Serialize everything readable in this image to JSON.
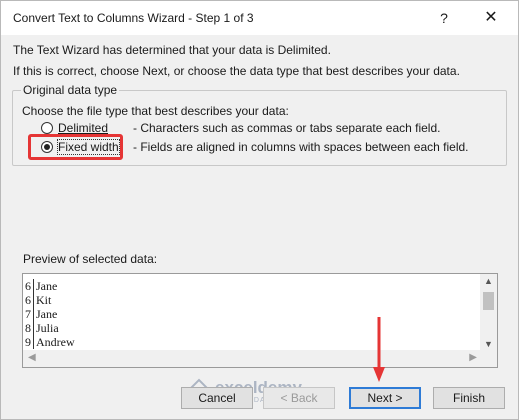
{
  "dialog": {
    "title": "Convert Text to Columns Wizard - Step 1 of 3",
    "help_glyph": "?",
    "close_glyph": "✕",
    "intro_line1": "The Text Wizard has determined that your data is Delimited.",
    "intro_line2": "If this is correct, choose Next, or choose the data type that best describes your data."
  },
  "original_data_type": {
    "legend": "Original data type",
    "prompt": "Choose the file type that best describes your data:",
    "options": [
      {
        "label": "Delimited",
        "description": "- Characters such as commas or tabs separate each field.",
        "selected": false
      },
      {
        "label": "Fixed width",
        "description": "- Fields are aligned in columns with spaces between each field.",
        "selected": true
      }
    ]
  },
  "preview": {
    "label": "Preview of selected data:",
    "rows": [
      {
        "num": "6",
        "value": "Jane"
      },
      {
        "num": "6",
        "value": "Kit"
      },
      {
        "num": "7",
        "value": "Jane"
      },
      {
        "num": "8",
        "value": "Julia"
      },
      {
        "num": "9",
        "value": "Andrew"
      }
    ]
  },
  "buttons": {
    "cancel": "Cancel",
    "back": "< Back",
    "next": "Next >",
    "finish": "Finish"
  },
  "watermark": {
    "name": "exceldemy",
    "tagline": "EXCEL · DATA · BI"
  },
  "colors": {
    "annotation": "#e53535",
    "primary_border": "#2e7bd6"
  }
}
